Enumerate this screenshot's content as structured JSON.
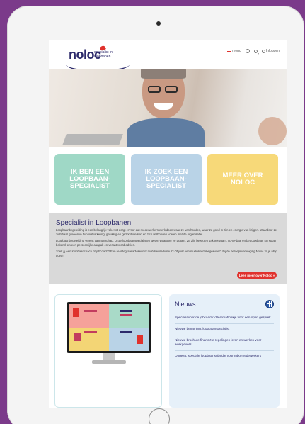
{
  "header": {
    "logo_word": "noloc",
    "logo_tagline": "specialist in loopbanen",
    "menu_label": "menu",
    "login_label": "Inloggen"
  },
  "cta": [
    {
      "label": "IK BEN EEN\nLOOPBAAN-\nSPECIALIST",
      "color": "#9fd8c6"
    },
    {
      "label": "IK ZOEK EEN\nLOOPBAAN-\nSPECIALIST",
      "color": "#b9d3e7"
    },
    {
      "label": "MEER OVER\nNOLOC",
      "color": "#f7d979"
    }
  ],
  "about": {
    "title": "Specialist in Loopbanen",
    "paragraphs": [
      "Loopbaanbegeleiding is een belangrijk vak. Het zorgt ervoor dat medewerkers werk doen waar ze van houden, waar ze goed in zijn en energie van krijgen. Waardoor ze zichtbaar groeien in hun ontwikkeling, gelukkig en gezond werken en zich verbonden voelen met de organisatie.",
      "Loopbaanbegeleiding vereist vakmanschap. Onze loopbaanspecialisten weten waarover ze praten: Ze zijn bewezen vakbekwaam, up-to-date en betrouwbaar. En staan bekend om een persoonlijke aanpak en verantwoord advies.",
      "Zoek jij een loopbaancoach of jobcoach? Een re-integratieadviseur of mobiliteitsadviseur? Of juist een studiekeuzebegeleider? Bij de beroepsvereniging Noloc zit je altijd goed!"
    ],
    "button_label": "Lees meer over Noloc »"
  },
  "news": {
    "title": "Nieuws",
    "items": [
      "Speciaal voor de jobcoach: dilemmaboekje voor een open gesprek",
      "Nieuwe benaming: loopbaanspecialist",
      "Nieuwe brochure financiële regelingen leren en werken voor werkgevers",
      "Opgelet: speciale loopbaansubsidie voor mbo-medewerkers"
    ]
  },
  "colors": {
    "brand_navy": "#2c2a6b",
    "accent_red": "#e0322d",
    "frame_purple": "#7b3a8a"
  }
}
